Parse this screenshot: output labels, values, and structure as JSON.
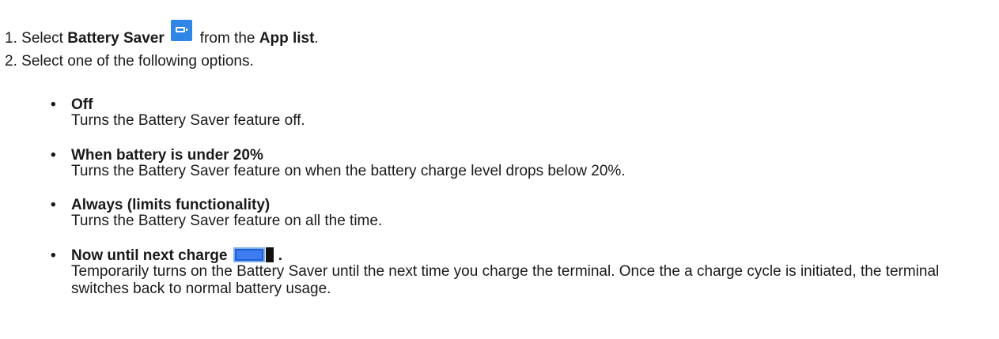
{
  "steps": [
    {
      "number": "1.",
      "prefix": "Select",
      "bold_app": "Battery Saver",
      "icon": "battery-saver-app-icon",
      "middle": "from the",
      "bold_list": "App list",
      "suffix": "."
    },
    {
      "number": "2.",
      "text": "Select one of the following options."
    }
  ],
  "options": [
    {
      "title": "Off",
      "description": "Turns the Battery Saver feature off."
    },
    {
      "title": "When battery is under 20%",
      "description": "Turns the Battery Saver feature on when the battery charge level drops below 20%."
    },
    {
      "title": "Always (limits functionality)",
      "description": "Turns the Battery Saver feature on all the time."
    },
    {
      "title": "Now until next charge",
      "title_suffix": ".",
      "icon": "battery-charge-icon",
      "description": "Temporarily turns on the Battery Saver until the next time you charge the terminal. Once the a charge cycle is initiated, the terminal switches back to normal battery usage."
    }
  ],
  "bullet": "•",
  "colors": {
    "app_icon_bg": "#2f86e6",
    "charge_icon_fill": "#3d7df0",
    "text": "#1a1a1a"
  }
}
